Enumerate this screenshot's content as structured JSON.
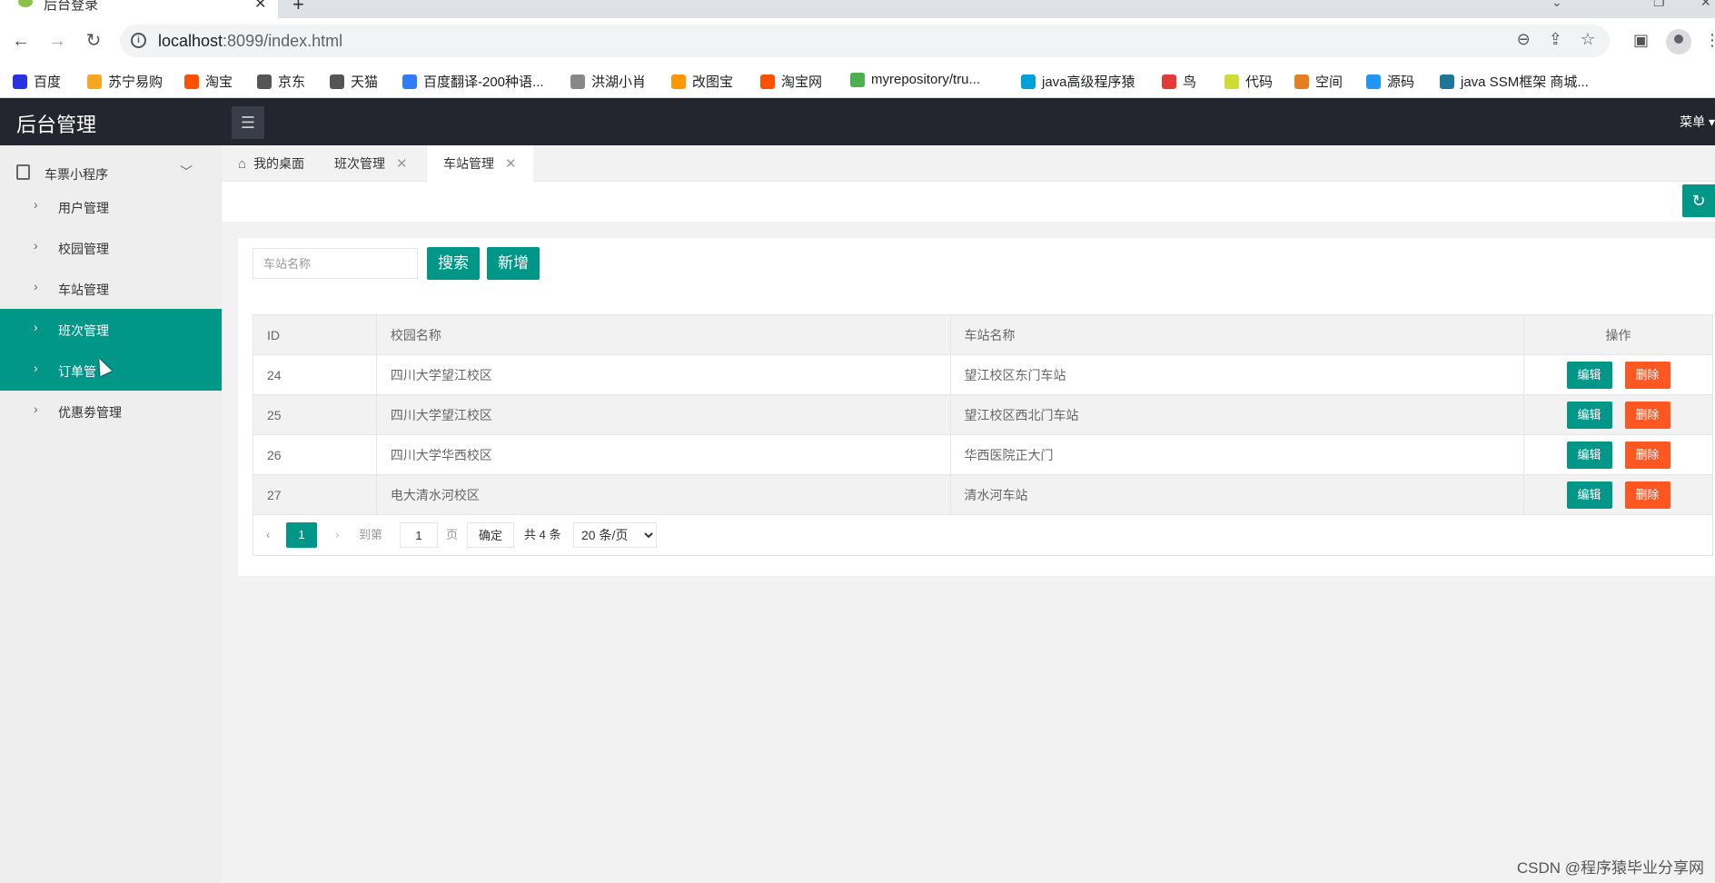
{
  "browser": {
    "tab_title": "后台登录",
    "url_host": "localhost",
    "url_rest": ":8099/index.html",
    "bookmarks": [
      {
        "label": "百度",
        "color": "#2932e1"
      },
      {
        "label": "苏宁易购",
        "color": "#f5a623"
      },
      {
        "label": "淘宝",
        "color": "#ff5000"
      },
      {
        "label": "京东",
        "color": "#555555"
      },
      {
        "label": "天猫",
        "color": "#555555"
      },
      {
        "label": "百度翻译-200种语...",
        "color": "#2f7cf6"
      },
      {
        "label": "洪湖小肖",
        "color": "#888888"
      },
      {
        "label": "改图宝",
        "color": "#ff9800"
      },
      {
        "label": "淘宝网",
        "color": "#ff5000"
      },
      {
        "label": "myrepository/tru...",
        "color": "#4caf50"
      },
      {
        "label": "java高级程序猿",
        "color": "#00a1d6"
      },
      {
        "label": "鸟",
        "color": "#e53935"
      },
      {
        "label": "代码",
        "color": "#cddc39"
      },
      {
        "label": "空间",
        "color": "#e67e22"
      },
      {
        "label": "源码",
        "color": "#2196f3"
      },
      {
        "label": "java SSM框架 商城...",
        "color": "#21759b"
      }
    ]
  },
  "header": {
    "logo": "后台管理",
    "menu_label": "菜单"
  },
  "sidebar": {
    "group_label": "车票小程序",
    "items": [
      {
        "label": "用户管理",
        "active": false
      },
      {
        "label": "校园管理",
        "active": false
      },
      {
        "label": "车站管理",
        "active": false
      },
      {
        "label": "班次管理",
        "active": true
      },
      {
        "label": "订单管",
        "active": true
      },
      {
        "label": "优惠劵管理",
        "active": false
      }
    ]
  },
  "tabs": [
    {
      "label": "我的桌面",
      "active": false
    },
    {
      "label": "班次管理",
      "active": false
    },
    {
      "label": "车站管理",
      "active": true
    }
  ],
  "search": {
    "placeholder": "车站名称",
    "search_label": "搜索",
    "add_label": "新增"
  },
  "table": {
    "columns": [
      "ID",
      "校园名称",
      "车站名称",
      "操作"
    ],
    "rows": [
      {
        "id": "24",
        "campus": "四川大学望江校区",
        "station": "望江校区东门车站"
      },
      {
        "id": "25",
        "campus": "四川大学望江校区",
        "station": "望江校区西北门车站"
      },
      {
        "id": "26",
        "campus": "四川大学华西校区",
        "station": "华西医院正大门"
      },
      {
        "id": "27",
        "campus": "电大清水河校区",
        "station": "清水河车站"
      }
    ],
    "edit_label": "编辑",
    "delete_label": "删除"
  },
  "pager": {
    "current_page": "1",
    "goto_label": "到第",
    "goto_value": "1",
    "page_unit": "页",
    "confirm_label": "确定",
    "total_label": "共 4 条",
    "page_size": "20 条/页"
  },
  "watermark": "CSDN @程序猿毕业分享网",
  "colors": {
    "primary": "#009688",
    "danger": "#ff5722",
    "header_bg": "#23262e"
  }
}
